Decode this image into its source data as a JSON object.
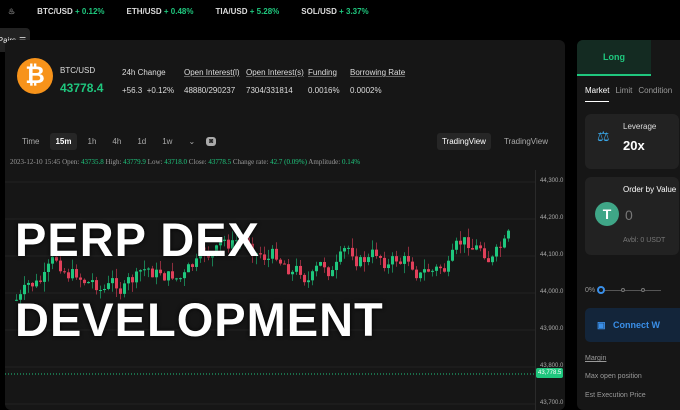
{
  "ticker": [
    {
      "pair": "BTC/USD",
      "change": "+ 0.12%"
    },
    {
      "pair": "ETH/USD",
      "change": "+ 0.48%"
    },
    {
      "pair": "TIA/USD",
      "change": "+ 5.28%"
    },
    {
      "pair": "SOL/USD",
      "change": "+ 3.37%"
    }
  ],
  "pairs_label": "Pairs",
  "market": {
    "pair": "BTC/USD",
    "price": "43778.4",
    "stats": [
      {
        "label": "24h Change",
        "value": "+56.3",
        "value2": "+0.12%"
      },
      {
        "label": "Open Interest(l)",
        "value": "48880/290237"
      },
      {
        "label": "Open Interest(s)",
        "value": "7304/331814"
      },
      {
        "label": "Funding",
        "value": "0.0016%"
      },
      {
        "label": "Borrowing Rate",
        "value": "0.0002%"
      }
    ]
  },
  "timeframes": [
    "Time",
    "15m",
    "1h",
    "4h",
    "1d",
    "1w"
  ],
  "views": [
    "TradingView",
    "TradingView"
  ],
  "ohlc": {
    "date": "2023-12-10 15:45",
    "open_l": "Open:",
    "open": "43735.8",
    "high_l": "High:",
    "high": "43779.9",
    "low_l": "Low:",
    "low": "43718.0",
    "close_l": "Close:",
    "close": "43778.5",
    "rate_l": "Change rate:",
    "rate": "42.7 (0.09%)",
    "amp_l": "Amplitude:",
    "amp": "0.14%"
  },
  "price_axis": [
    "44,300.0",
    "44,200.0",
    "44,100.0",
    "44,000.0",
    "43,900.0",
    "43,800.0",
    "43,700.0"
  ],
  "current_price": "43,778.5",
  "headline": [
    "PERP DEX",
    "DEVELOPMENT"
  ],
  "order": {
    "side": "Long",
    "tabs": [
      "Market",
      "Limit",
      "Condition"
    ],
    "leverage_label": "Leverage",
    "leverage": "20x",
    "value_label": "Order by Value",
    "value": "0",
    "avbl": "Avbl: 0 USDT",
    "pct": "0%",
    "connect": "Connect W",
    "info": [
      "Margin",
      "Max open position",
      "Est Execution Price"
    ]
  },
  "colors": {
    "up": "#1fc77e",
    "down": "#e0405a",
    "accent": "#3a8fe8"
  }
}
